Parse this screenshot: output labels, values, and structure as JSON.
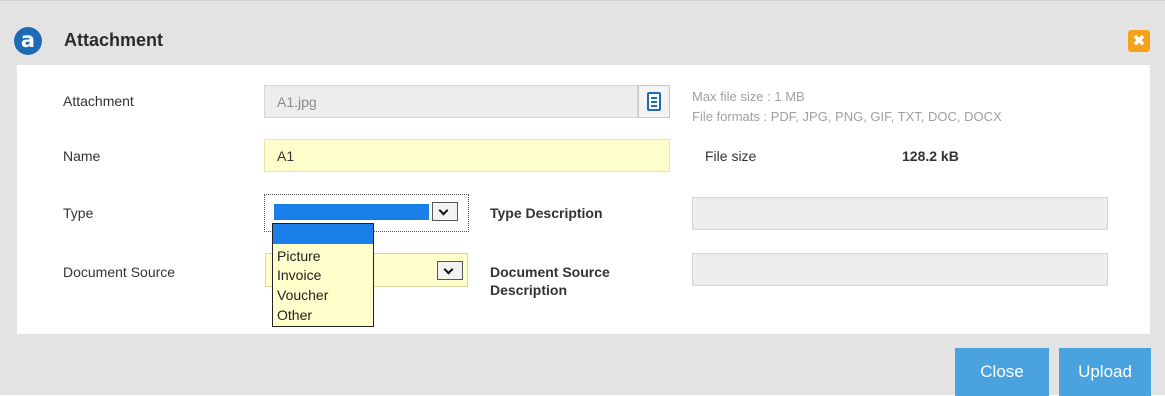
{
  "dialog": {
    "logo_letter": "a",
    "title": "Attachment",
    "close_symbol": "✖"
  },
  "form": {
    "attachment": {
      "label": "Attachment",
      "value": "A1.jpg",
      "hint_max_size": "Max file size : 1 MB",
      "hint_formats": "File formats : PDF, JPG, PNG, GIF, TXT, DOC, DOCX"
    },
    "name": {
      "label": "Name",
      "value": "A1",
      "file_size_label": "File size",
      "file_size_value": "128.2 kB"
    },
    "type": {
      "label": "Type",
      "selected": "",
      "options": [
        "",
        "Picture",
        "Invoice",
        "Voucher",
        "Other"
      ],
      "description_label": "Type Description",
      "description_value": ""
    },
    "document_source": {
      "label": "Document Source",
      "selected": "",
      "description_label_line1": "Document Source",
      "description_label_line2": "Description",
      "description_value": ""
    }
  },
  "footer": {
    "close_label": "Close",
    "upload_label": "Upload"
  },
  "icons": {
    "logo": "app-logo-icon",
    "close": "close-icon",
    "browse": "file-browse-icon",
    "dropdown": "chevron-down-icon"
  },
  "colors": {
    "accent_blue": "#4aa3df",
    "selection_blue": "#1a7fe8",
    "close_orange": "#f4a21c",
    "field_yellow": "#ffffcc"
  }
}
